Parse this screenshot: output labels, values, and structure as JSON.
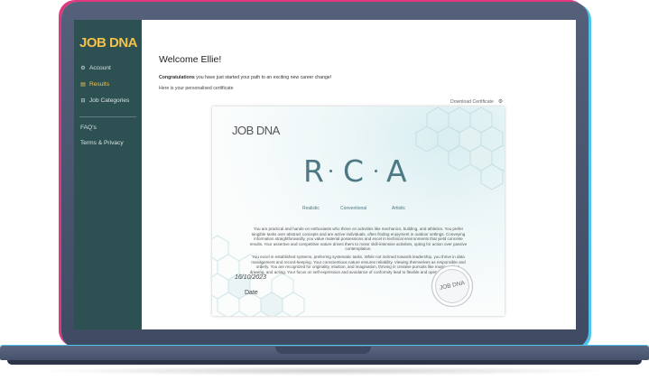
{
  "app": {
    "logo": "JOB DNA"
  },
  "sidebar": {
    "items": [
      {
        "label": "Account",
        "icon": "gear-icon"
      },
      {
        "label": "Results",
        "icon": "results-icon"
      },
      {
        "label": "Job Categories",
        "icon": "briefcase-icon"
      }
    ],
    "secondary": [
      {
        "label": "FAQ's"
      },
      {
        "label": "Terms & Privacy"
      }
    ]
  },
  "main": {
    "welcome": "Welcome Ellie!",
    "congrats_bold": "Congratulations",
    "congrats_rest": " you have just started your path to an exciting new career change!",
    "here": "Here is your personalised certificate",
    "download_label": "Download Certificate"
  },
  "certificate": {
    "logo": "JOB DNA",
    "letters": [
      {
        "letter": "R",
        "label": "Realistic"
      },
      {
        "letter": "C",
        "label": "Conventional"
      },
      {
        "letter": "A",
        "label": "Artistic"
      }
    ],
    "paragraph1": "You are practical and hands-on enthusiasts who thrive on activities like mechanics, building, and athletics. You prefer tangible tasks over abstract concepts and are active individuals, often finding enjoyment in outdoor settings. Conveying information straightforwardly, you value material possessions and excel in technical environments that yield concrete results. Your assertive and competitive nature drives them to motor skill-intensive activities, opting for action over passive contemplation.",
    "paragraph2": "You excel in established systems, preferring systematic tasks. While not inclined towards leadership, you thrive in data management and record-keeping. Your conscientious nature ensures reliability. Viewing themselves as responsible and orderly. You are recognized for originality, intuition, and imagination, thriving in creative pursuits like music, writing, drawing, and acting. Your focus on self-expression and avoidance of conformity lead to flexible and open communication.",
    "date": "16/10/2023",
    "date_label": "Date",
    "seal_text": "JOB DNA"
  },
  "colors": {
    "sidebar_bg": "#2d5152",
    "accent_yellow": "#f2c14e",
    "cert_teal": "#4d7884",
    "laptop_pink": "#e2367f",
    "laptop_blue": "#4cc4ee"
  }
}
